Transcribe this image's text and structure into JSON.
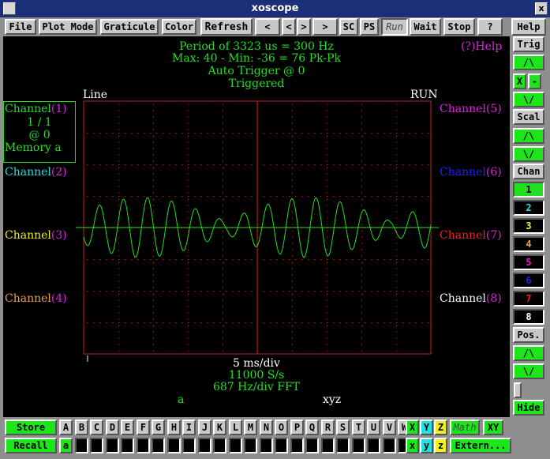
{
  "window": {
    "title": "xoscope",
    "close_glyph": "x"
  },
  "menubar": {
    "file": "File",
    "plot_mode": "Plot Mode",
    "graticule": "Graticule",
    "color": "Color",
    "refresh": "Refresh",
    "lt": "<",
    "lt2": "<",
    "gt2": ">",
    "gt": ">",
    "sc": "SC",
    "ps": "PS",
    "run": "Run",
    "wait": "Wait",
    "stop": "Stop",
    "question": "?",
    "help": "Help"
  },
  "scope": {
    "period_line": "Period of   3323 us =   300 Hz",
    "maxmin_line": "Max: 40 - Min: -36 =  76 Pk-Pk",
    "trigger_line": "Auto Trigger @ 0",
    "triggered": "Triggered",
    "help_label": "(?)Help",
    "line_label": "Line",
    "run_label": "RUN",
    "timebase": "5 ms/div",
    "sample_rate": "11000 S/s",
    "fft_line": "687 Hz/div FFT",
    "math_a": "a",
    "math_xyz": "xyz"
  },
  "channels_left": [
    {
      "word": "Channel",
      "num": "(1)",
      "word_color": "#20e020",
      "num_color": "#e020e0"
    },
    {
      "word": "Channel",
      "num": "(2)",
      "word_color": "#20e0e0",
      "num_color": "#e020e0"
    },
    {
      "word": "Channel",
      "num": "(3)",
      "word_color": "#f0f020",
      "num_color": "#e020e0"
    },
    {
      "word": "Channel",
      "num": "(4)",
      "word_color": "#f0a040",
      "num_color": "#e020e0"
    }
  ],
  "ch1_info": {
    "line1": "1 / 1",
    "line2": "@ 0",
    "line3": "Memory a"
  },
  "channels_right": [
    {
      "word": "Channel",
      "num": "(5)",
      "word_color": "#e020e0",
      "num_color": "#e020e0"
    },
    {
      "word": "Channel",
      "num": "(6)",
      "word_color": "#2020f0",
      "num_color": "#e020e0"
    },
    {
      "word": "Channel",
      "num": "(7)",
      "word_color": "#f02020",
      "num_color": "#e020e0"
    },
    {
      "word": "Channel",
      "num": "(8)",
      "word_color": "#ffffff",
      "num_color": "#e020e0"
    }
  ],
  "right_panel": {
    "trig": "Trig",
    "up": "/\\",
    "down": "\\/",
    "x": "X",
    "minus": "-",
    "scal": "Scal",
    "chan": "Chan",
    "pos": "Pos.",
    "hide": "Hide",
    "channel_buttons": [
      {
        "label": "1",
        "color": "#20e020",
        "bg": "#20e020",
        "fg": "#000000"
      },
      {
        "label": "2",
        "color": "#20e0e0",
        "bg": "#000000",
        "fg": "#20e0e0"
      },
      {
        "label": "3",
        "color": "#f0f020",
        "bg": "#000000",
        "fg": "#f0f020"
      },
      {
        "label": "4",
        "color": "#f0a040",
        "bg": "#000000",
        "fg": "#f0a040"
      },
      {
        "label": "5",
        "color": "#e020e0",
        "bg": "#000000",
        "fg": "#e020e0"
      },
      {
        "label": "6",
        "color": "#2020f0",
        "bg": "#000000",
        "fg": "#2020f0"
      },
      {
        "label": "7",
        "color": "#f02020",
        "bg": "#000000",
        "fg": "#f02020"
      },
      {
        "label": "8",
        "color": "#ffffff",
        "bg": "#000000",
        "fg": "#ffffff"
      }
    ]
  },
  "bottom": {
    "store": "Store",
    "recall": "Recall",
    "letters": [
      "A",
      "B",
      "C",
      "D",
      "E",
      "F",
      "G",
      "H",
      "I",
      "J",
      "K",
      "L",
      "M",
      "N",
      "O",
      "P",
      "Q",
      "R",
      "S",
      "T",
      "U",
      "V",
      "W"
    ],
    "xyz": [
      "X",
      "Y",
      "Z"
    ],
    "recall_a": "a",
    "recall_xyz": [
      "x",
      "y",
      "z"
    ],
    "math": "Math",
    "xy": "XY",
    "extern": "Extern..."
  },
  "colors": {
    "accent_green": "#1ae61a",
    "trace": "#20e020",
    "graticule": "#c81e1e",
    "text_green": "#20e020"
  }
}
